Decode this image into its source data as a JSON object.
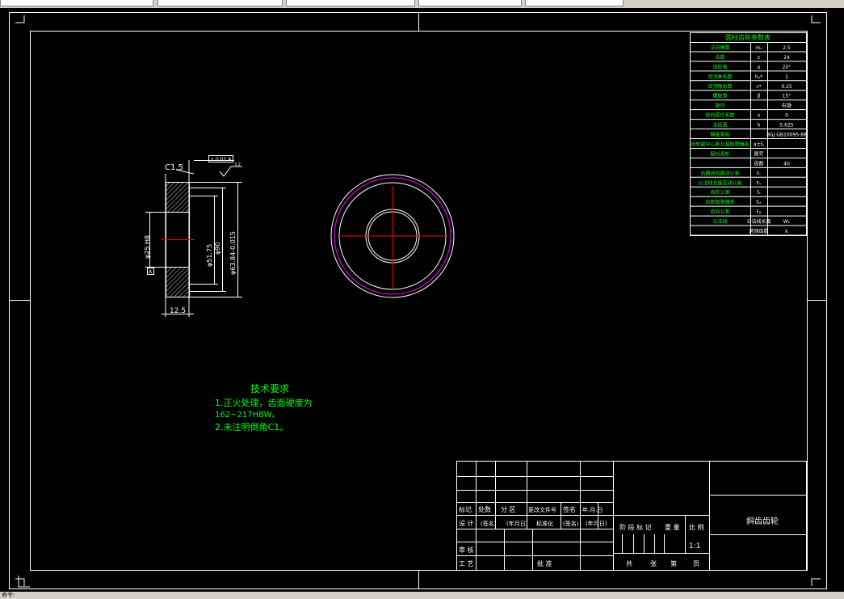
{
  "topbar": {
    "tabs": [
      "",
      "",
      "",
      "",
      ""
    ]
  },
  "params_table": {
    "title": "圆柱齿轮参数表",
    "rows": [
      [
        "法向模数",
        "mₙ",
        "2.5"
      ],
      [
        "齿数",
        "z",
        "24"
      ],
      [
        "齿形角",
        "α",
        "20°"
      ],
      [
        "齿顶高系数",
        "hₐ*",
        "1"
      ],
      [
        "齿顶隙系数",
        "c*",
        "0.25"
      ],
      [
        "螺旋角",
        "β",
        "15°"
      ],
      [
        "旋向",
        "",
        "右旋"
      ],
      [
        "径向变位系数",
        "x",
        "0"
      ],
      [
        "全齿高",
        "h",
        "5.625"
      ],
      [
        "精度等级",
        "",
        "8GJ GB10095-88"
      ],
      [
        "齿轮副中心距及其极限偏差",
        "a±fₐ",
        ""
      ],
      [
        "配对齿轮",
        "图号",
        ""
      ],
      [
        "",
        "齿数",
        "40"
      ],
      [
        "齿圈径向跳动公差",
        "Fᵣ",
        ""
      ],
      [
        "公法线长度变动公差",
        "Fᵥ",
        ""
      ],
      [
        "齿形公差",
        "fₑ",
        ""
      ],
      [
        "齿距极限偏差",
        "fₚₜ",
        ""
      ],
      [
        "齿向公差",
        "Fᵦ",
        ""
      ],
      [
        "公法线",
        "公法线长度",
        "Wₖ"
      ],
      [
        "",
        "跨测齿数",
        "k"
      ]
    ]
  },
  "section_view": {
    "chamfer": "C1.5",
    "runout": "↗ 0.02 A",
    "roughness": "3.2",
    "dim_width": "12.5",
    "dim_1": "φ25 H8",
    "dim_2": "φ51.75",
    "dim_3": "φ90",
    "dim_4": "φ63.84-0.015",
    "datum": "A"
  },
  "tech_req": {
    "title": "技术要求",
    "line1": "1.正火处理，齿面硬度为",
    "line2": "162~217HBW。",
    "line3": "2.未注明倒角C1。"
  },
  "title_block": {
    "rev_labels": [
      "标记",
      "处数",
      "分 区",
      "更改文件号",
      "签名",
      "年.月.日"
    ],
    "design": [
      "设 计",
      "(签名)",
      "(年月日)",
      "标准化",
      "(签名)",
      "(年月日)"
    ],
    "review": "审 核",
    "process": "工 艺",
    "approve": "批 准",
    "stage_labels": [
      "阶 段 标 记",
      "重 量",
      "比 例"
    ],
    "scale": "1:1",
    "sheets": [
      "共",
      "张",
      "第",
      "页"
    ],
    "part_name": "斜齿齿轮"
  },
  "status": "命令:"
}
